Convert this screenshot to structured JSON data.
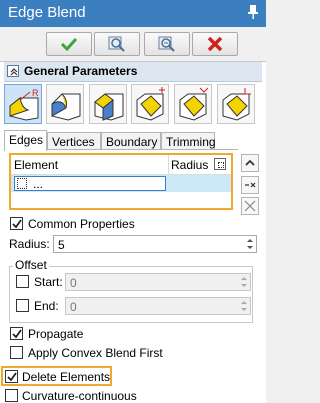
{
  "window": {
    "title": "Edge Blend"
  },
  "section": {
    "title": "General Parameters"
  },
  "tabs": [
    "Edges",
    "Vertices",
    "Boundary",
    "Trimming"
  ],
  "table": {
    "col_element": "Element",
    "col_radius": "Radius",
    "row_text": "..."
  },
  "common_properties": {
    "label": "Common Properties",
    "checked": true
  },
  "radius": {
    "label": "Radius:",
    "value": "5"
  },
  "offset": {
    "title": "Offset",
    "start": {
      "label": "Start:",
      "value": "0",
      "checked": false
    },
    "end": {
      "label": "End:",
      "value": "0",
      "checked": false
    }
  },
  "options": {
    "propagate": {
      "label": "Propagate",
      "checked": true
    },
    "convex": {
      "label": "Apply Convex Blend First",
      "checked": false
    },
    "delete": {
      "label": "Delete Elements",
      "checked": true
    },
    "curvature": {
      "label": "Curvature-continuous",
      "checked": false
    }
  },
  "colors": {
    "title_bar": "#3c7fc1",
    "accent_orange": "#f0a830",
    "ok_green": "#3aa53a",
    "cancel_red": "#d02020"
  }
}
